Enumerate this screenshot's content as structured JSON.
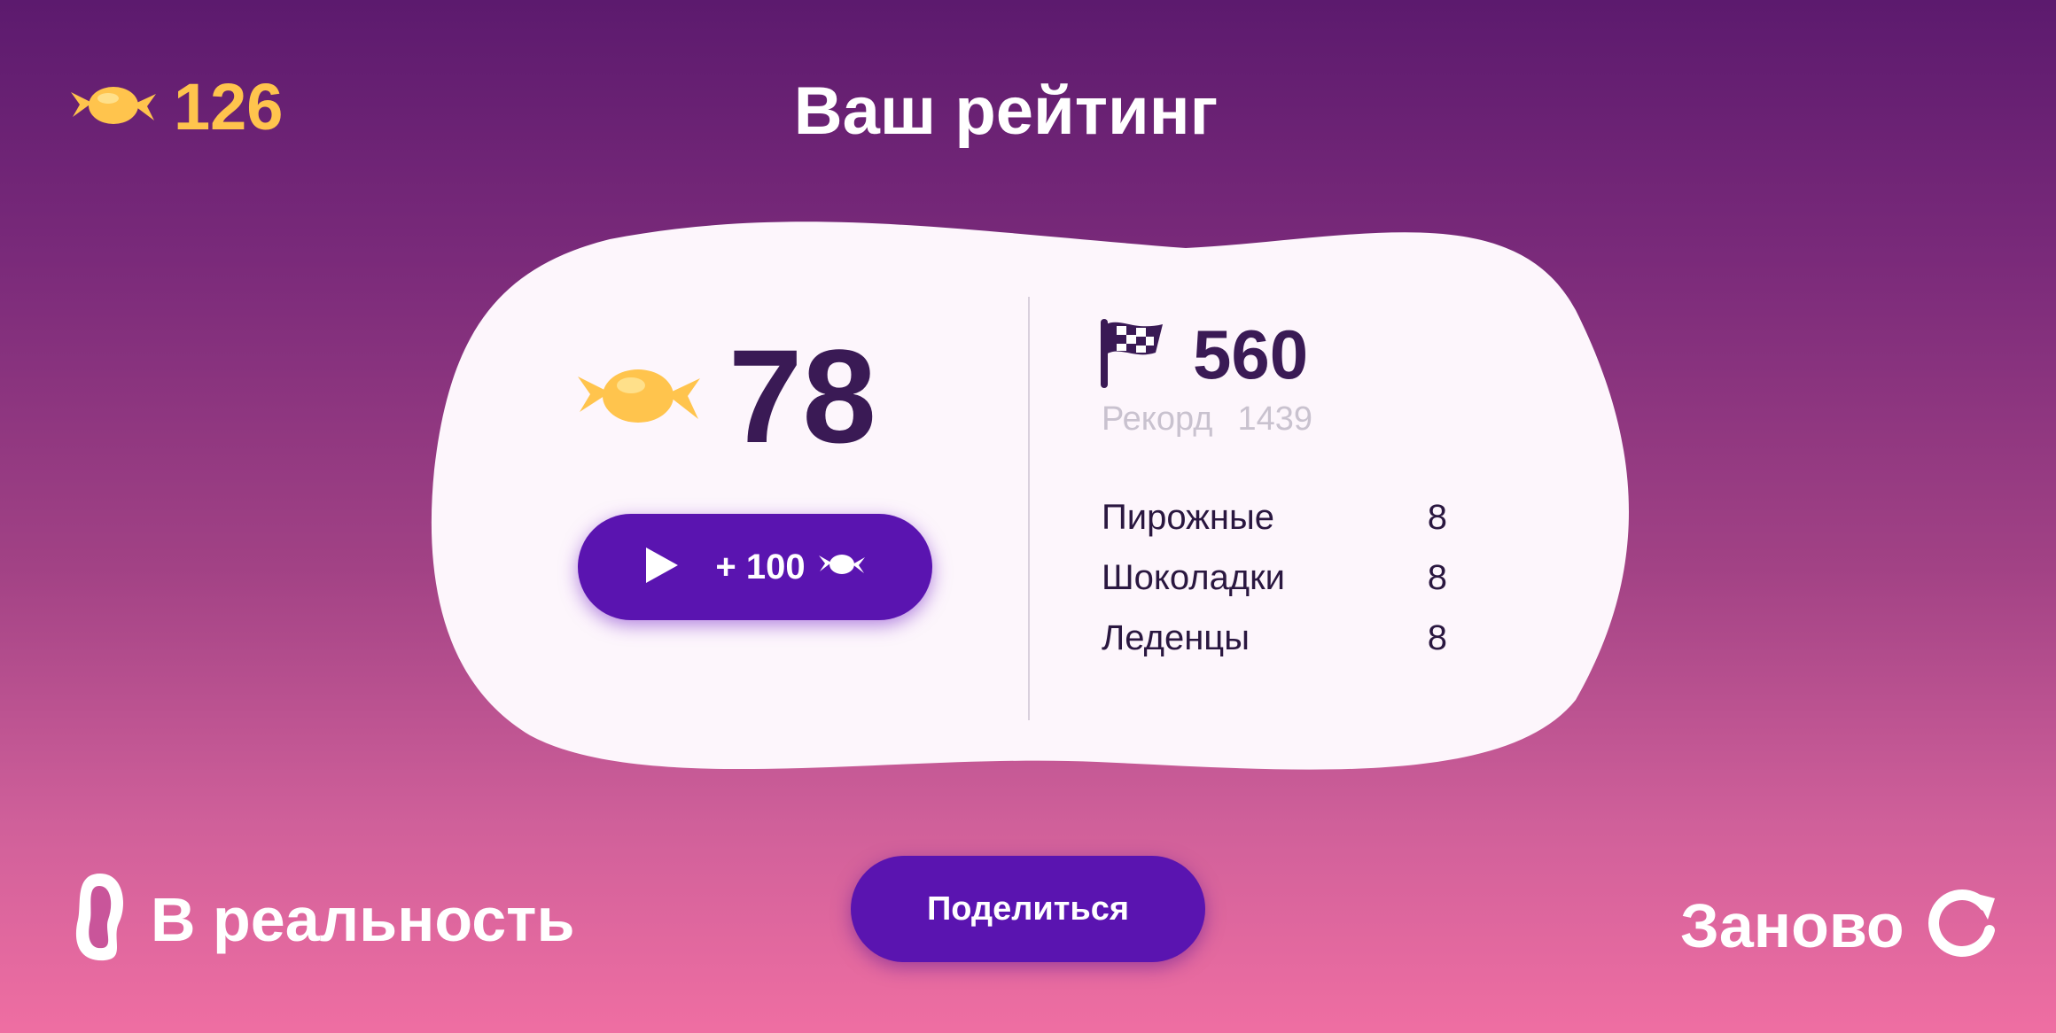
{
  "header": {
    "coins": "126",
    "title": "Ваш рейтинг"
  },
  "result": {
    "score": "78",
    "play_bonus": "+ 100"
  },
  "best": {
    "score": "560",
    "record_label": "Рекорд",
    "record_value": "1439"
  },
  "stats": [
    {
      "label": "Пирожные",
      "value": "8"
    },
    {
      "label": "Шоколадки",
      "value": "8"
    },
    {
      "label": "Леденцы",
      "value": "8"
    }
  ],
  "footer": {
    "back_label": "В реальность",
    "share_label": "Поделиться",
    "again_label": "Заново"
  },
  "icons": {
    "candy": "candy-icon",
    "flag": "checkered-flag-icon",
    "play": "play-icon",
    "portal": "portal-icon",
    "restart": "restart-icon"
  },
  "colors": {
    "accent": "#5a14b0",
    "coins": "#ffc44d",
    "dark_text": "#3a1a55",
    "card": "#fdf6fc"
  }
}
